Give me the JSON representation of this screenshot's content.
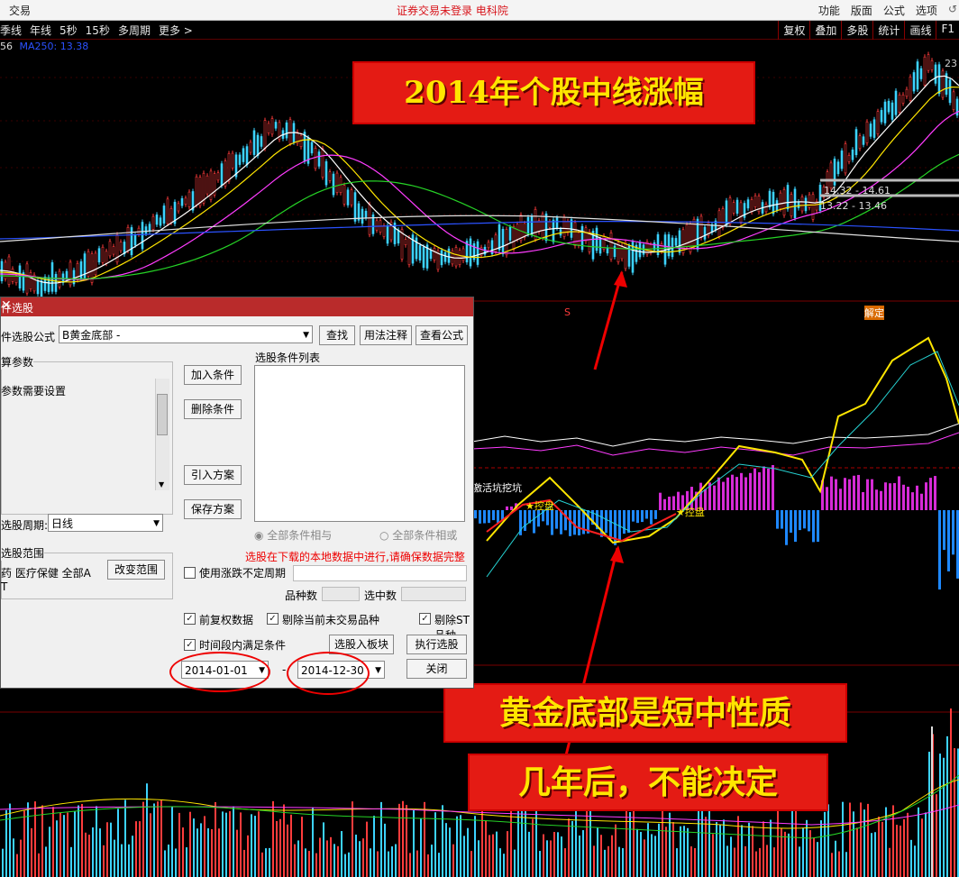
{
  "topbar": {
    "app_label": "交易",
    "status": "证券交易未登录  电科院",
    "menu": [
      "功能",
      "版面",
      "公式",
      "选项"
    ],
    "icon": "refresh-icon"
  },
  "toolbar": {
    "periods": [
      "季线",
      "年线",
      "5秒",
      "15秒",
      "多周期",
      "更多 >"
    ],
    "tools": [
      "复权",
      "叠加",
      "多股",
      "统计",
      "画线",
      "F1"
    ]
  },
  "ma_legend": {
    "prefix": "56",
    "label": "MA250: 13.38",
    "color": "#2b52ff"
  },
  "price_labels": {
    "peak": "23",
    "range1": "14.32 - 14.61",
    "range2": "13.22 - 13.46"
  },
  "indicator": {
    "marker_s": "S",
    "marker_jie": "解定",
    "tag_wa_keng": "激活坑挖坑",
    "tag_kong_pan1": "控盘",
    "tag_kong_pan2": "控盘"
  },
  "annotations": {
    "title": "2014年个股中线涨幅",
    "note1": "黄金底部是短中性质",
    "note2": "几年后，不能决定"
  },
  "dialog": {
    "title": "件选股",
    "formula_label": "件选股公式",
    "formula_value": "B黄金底部  -",
    "find_btn": "查找",
    "usage_btn": "用法注释",
    "view_btn": "查看公式",
    "params_group": "算参数",
    "params_text": "参数需要设置",
    "cond_list_label": "选股条件列表",
    "add_cond": "加入条件",
    "del_cond": "删除条件",
    "import_plan": "引入方案",
    "save_plan": "保存方案",
    "all_and": "全部条件相与",
    "all_or": "全部条件相或",
    "period_label": "选股周期:",
    "period_value": "日线",
    "range_group": "选股范围",
    "range_text": "药 医疗保健 全部A",
    "range_extra": "T",
    "change_range": "改变范围",
    "warning": "选股在下载的本地数据中进行,请确保数据完整",
    "use_updown": "使用涨跌不定周期",
    "count_label": "品种数",
    "selected_label": "选中数",
    "fq_data": "前复权数据",
    "exclude_untraded": "剔除当前未交易品种",
    "exclude_st": "剔除ST品种",
    "time_range": "时间段内满足条件",
    "to_block": "选股入板块",
    "run": "执行选股",
    "close": "关闭",
    "date_from": "2014-01-01",
    "date_to": "2014-12-30",
    "date_sep": "-"
  }
}
